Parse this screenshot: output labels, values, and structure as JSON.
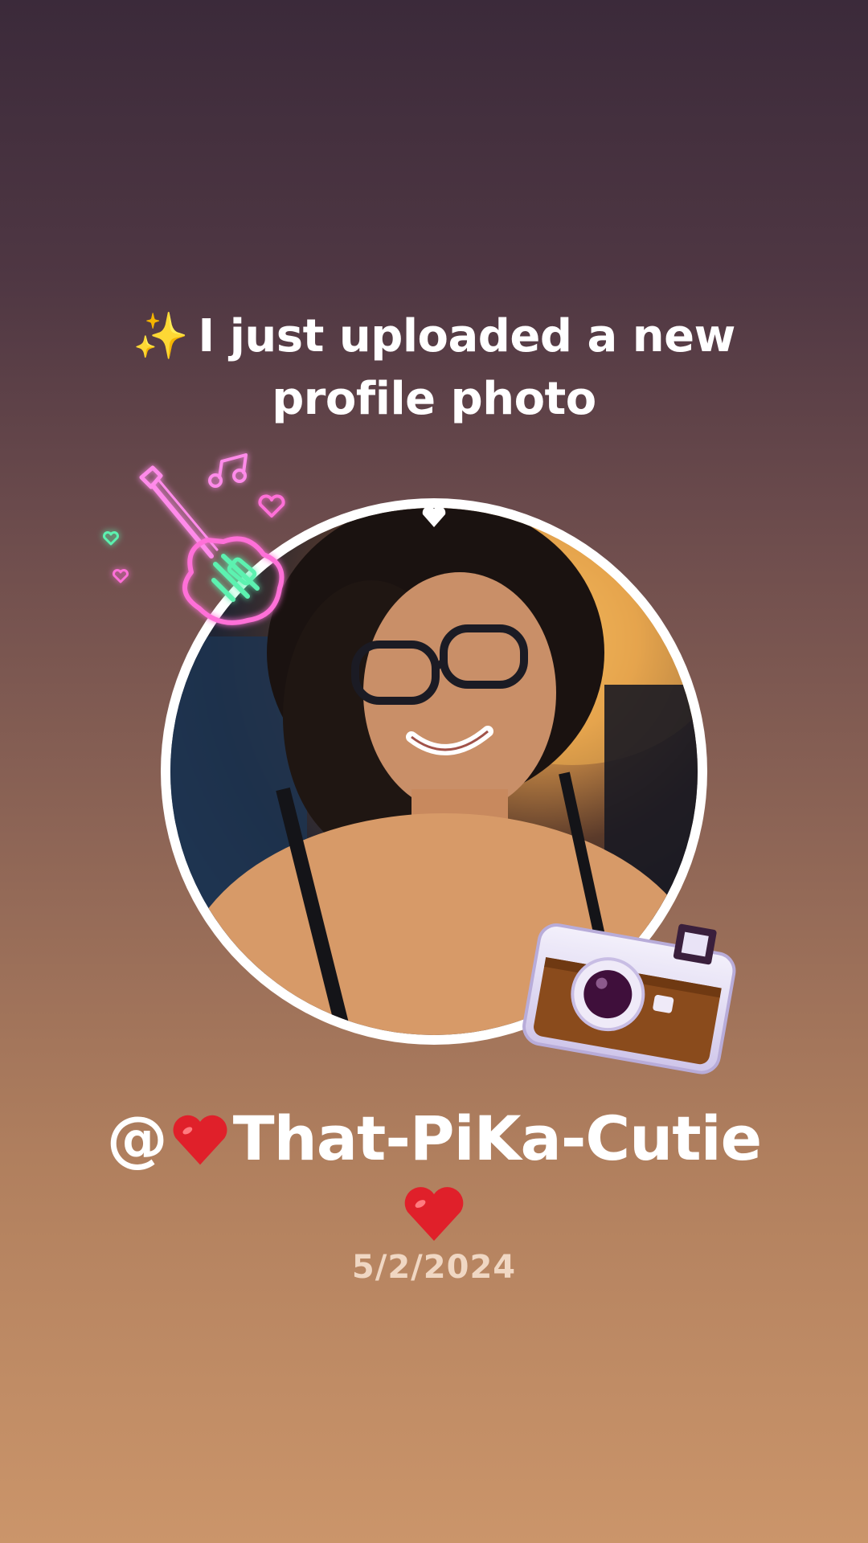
{
  "post": {
    "sparkle_icon": "✨",
    "headline": "I just uploaded a new profile photo",
    "username_prefix": "@",
    "username_name": "That-PiKa-Cutie",
    "date": "5/2/2024"
  },
  "stickers": {
    "guitar": "neon-guitar-sticker",
    "camera": "camera-sticker",
    "heart": "red-heart-icon"
  },
  "colors": {
    "bg_top": "#3b2a3a",
    "bg_bottom": "#cb956a",
    "text": "#ffffff",
    "date_text": "#f0d7c3",
    "heart": "#e0202a",
    "neon_pink": "#ff6fd8",
    "neon_green": "#5cf2b0"
  }
}
